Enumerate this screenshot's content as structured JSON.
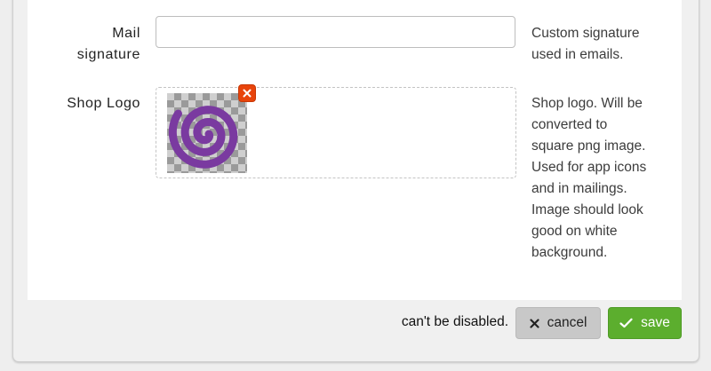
{
  "form": {
    "mail_signature": {
      "label_line1": "Mail",
      "label_line2": "signature",
      "value": "",
      "help_line1": "Custom signature",
      "help_line2": "used in emails."
    },
    "shop_logo": {
      "label": "Shop Logo",
      "help_lines": [
        "Shop logo. Will be",
        "converted to",
        "square png image.",
        "Used for app icons",
        "and in mailings.",
        "Image should look",
        "good on white",
        "background."
      ]
    }
  },
  "footer": {
    "message": "can't be disabled.",
    "cancel_label": "cancel",
    "save_label": "save"
  },
  "colors": {
    "accent_save": "#5cae2e",
    "remove_badge": "#e8440b",
    "logo_purple": "#7a3aa0"
  }
}
